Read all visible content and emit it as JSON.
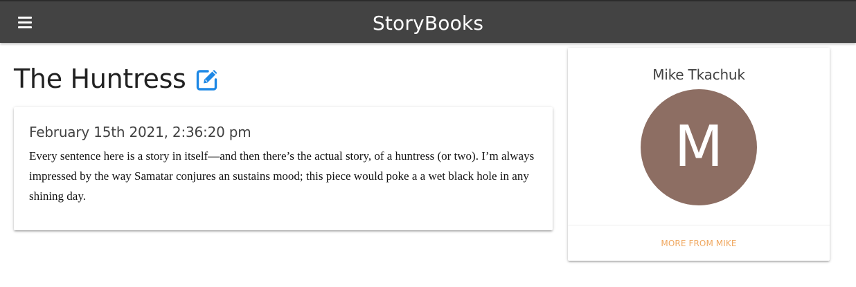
{
  "navbar": {
    "brand": "StoryBooks",
    "menu_icon": "hamburger-menu-icon",
    "background_color": "#434343"
  },
  "story": {
    "title": "The Huntress",
    "edit_icon": "edit-icon",
    "edit_icon_color": "#1e88e5",
    "date": "February 15th 2021, 2:36:20 pm",
    "body": "Every sentence here is a story in itself—and then there’s the actual story, of a huntress (or two). I’m always impressed by the way Samatar conjures an sustains mood; this piece would poke a a wet black hole in any shining day."
  },
  "author": {
    "name": "Mike Tkachuk",
    "avatar_initial": "M",
    "avatar_color": "#8d6e63",
    "more_link": "MORE FROM MIKE",
    "more_link_color": "#f0a860"
  }
}
